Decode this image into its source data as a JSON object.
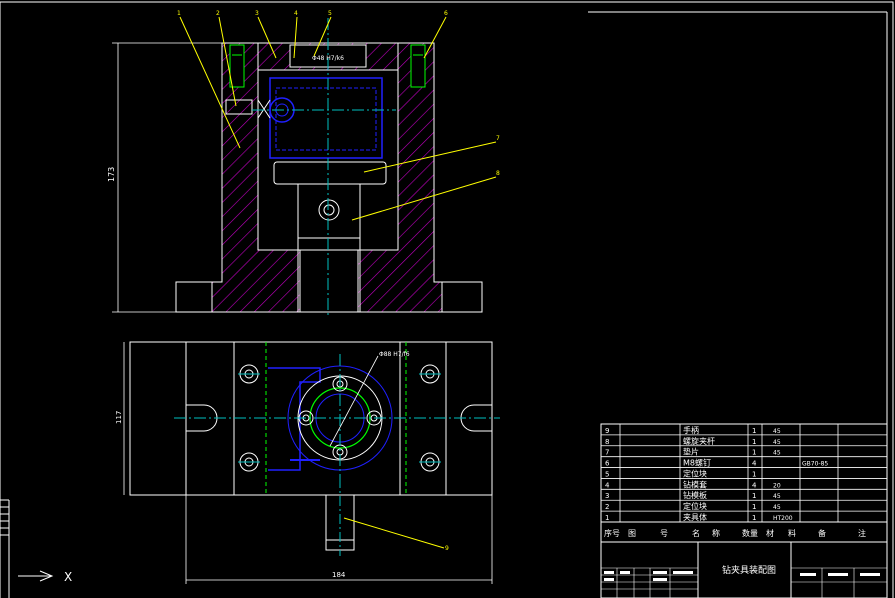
{
  "drawing": {
    "balloons": [
      "1",
      "2",
      "3",
      "4",
      "5",
      "6",
      "7",
      "8",
      "9"
    ],
    "dim_front_height": "173",
    "dim_top_height": "117",
    "dim_top_width": "184",
    "front_note": "Φ48 H7/k6",
    "top_note": "Φ88 H7/f6"
  },
  "title_block": {
    "title": "钻夹具装配图",
    "headers": [
      "序号",
      "图",
      "号",
      "名",
      "称",
      "数量",
      "材",
      "料",
      "备",
      "注"
    ],
    "rows": [
      {
        "no": "9",
        "name": "手柄",
        "qty": "1",
        "mat": "45",
        "note": ""
      },
      {
        "no": "8",
        "name": "螺旋夹杆",
        "qty": "1",
        "mat": "45",
        "note": ""
      },
      {
        "no": "7",
        "name": "垫片",
        "qty": "1",
        "mat": "45",
        "note": ""
      },
      {
        "no": "6",
        "name": "M8螺钉",
        "qty": "4",
        "mat": "",
        "note": "GB70-85"
      },
      {
        "no": "5",
        "name": "定位块",
        "qty": "1",
        "mat": "",
        "note": ""
      },
      {
        "no": "4",
        "name": "钻模套",
        "qty": "4",
        "mat": "20",
        "note": ""
      },
      {
        "no": "3",
        "name": "钻模板",
        "qty": "1",
        "mat": "45",
        "note": ""
      },
      {
        "no": "2",
        "name": "定位块",
        "qty": "1",
        "mat": "45",
        "note": ""
      },
      {
        "no": "1",
        "name": "夹具体",
        "qty": "1",
        "mat": "HT200",
        "note": ""
      }
    ]
  },
  "ucs": {
    "x_label": "X"
  },
  "colors": {
    "outline": "#ffffff",
    "hatch": "#c000c0",
    "center": "#00c0c0",
    "blue": "#2020ff",
    "green": "#00ff00",
    "leader": "#ffff00",
    "dim": "#ffffff"
  }
}
